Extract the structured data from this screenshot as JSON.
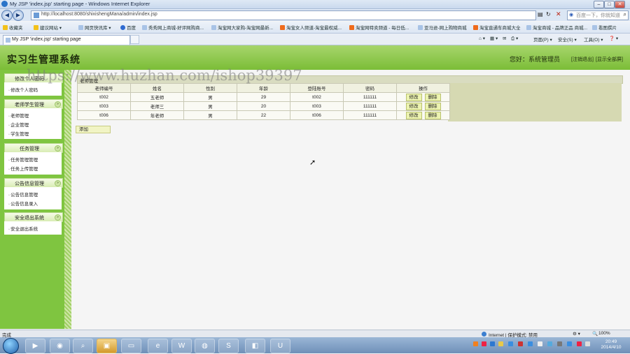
{
  "window": {
    "title": "My JSP 'index.jsp' starting page - Windows Internet Explorer"
  },
  "address_bar": {
    "url": "http://localhost:8080/shixisheng​Mana/admin/index.jsp",
    "search_placeholder": "百度一下，你就知道"
  },
  "favorites": {
    "label": "收藏夹",
    "items": [
      "建议网站 ▾",
      "网页快讯库 ▾",
      "百度",
      "秀秀网上商城-好评网购商...",
      "淘宝网大家购-淘宝网最新...",
      "淘宝女人频道-淘宝最权威...",
      "淘宝网特卖频道 - 每日低...",
      "亚马逊-网上购物商城",
      "淘宝直通车商城大全",
      "淘宝商城 - 品牌正品 商城...",
      "看图撰片"
    ]
  },
  "tab": {
    "label": "My JSP 'index.jsp' starting page"
  },
  "command_bar": {
    "page": "页面(P) ▾",
    "safety": "安全(S) ▾",
    "tools": "工具(O) ▾",
    "help": "❓ ▾"
  },
  "header": {
    "system_title": "实习生管理系统",
    "greeting": "您好：系统管理员",
    "logout_link": "[注销退出]",
    "home_link": "[显示全部屏]"
  },
  "watermark": "https://www.huzhan.com/ishop39397",
  "sidebar": {
    "sections": [
      {
        "title": "修改个人密码",
        "items": [
          "修改个人密码"
        ]
      },
      {
        "title": "老师学生管理",
        "items": [
          "老师管理",
          "企业管理",
          "学生管理"
        ]
      },
      {
        "title": "任务管理",
        "items": [
          "任务管理管理",
          "任务上传管理"
        ]
      },
      {
        "title": "公告信息管理",
        "items": [
          "公告信息管理",
          "公告信息录入"
        ]
      },
      {
        "title": "安全退出系统",
        "items": [
          "安全退出系统"
        ]
      }
    ]
  },
  "grid": {
    "title": "老师管理",
    "columns": [
      "老师编号",
      "姓名",
      "性别",
      "年龄",
      "登陆账号",
      "密码",
      "操作"
    ],
    "rows": [
      [
        "t002",
        "五老师",
        "男",
        "29",
        "t002",
        "111111"
      ],
      [
        "t003",
        "老师三",
        "男",
        "20",
        "t003",
        "111111"
      ],
      [
        "t006",
        "年老师",
        "男",
        "22",
        "t006",
        "111111"
      ]
    ],
    "edit_label": "修改",
    "delete_label": "删除",
    "add_label": "添加"
  },
  "status_bar": {
    "left": "完成",
    "zone": "Internet | 保护模式: 禁用",
    "zoom": "100%"
  },
  "taskbar": {
    "time": "20:49",
    "date": "2014/4/10"
  }
}
